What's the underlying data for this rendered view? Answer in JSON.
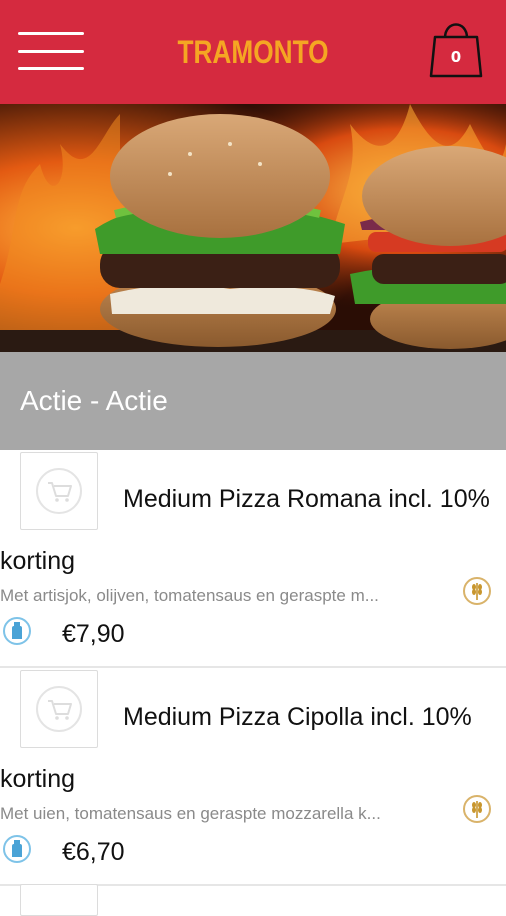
{
  "header": {
    "brand": "TRAMONTO",
    "cart_count": "0",
    "menu_icon": "hamburger-menu-icon",
    "cart_icon": "shopping-bag-icon",
    "background_color": "#d52a3f",
    "brand_color": "#f5a623"
  },
  "hero": {
    "image": "burgers-with-flames"
  },
  "section": {
    "title": "Actie - Actie",
    "background_color": "#a7a7a7"
  },
  "products": [
    {
      "title": "Medium Pizza Romana incl. 10% korting",
      "description": "Met artisjok, olijven, tomatensaus en geraspte m...",
      "price": "€7,90",
      "thumb_icon": "cart-placeholder-icon",
      "allergen_icon": "wheat-gluten-icon",
      "extra_icon": "bottle-icon"
    },
    {
      "title": "Medium Pizza Cipolla incl. 10% korting",
      "description": "Met uien, tomatensaus en geraspte mozzarella k...",
      "price": "€6,70",
      "thumb_icon": "cart-placeholder-icon",
      "allergen_icon": "wheat-gluten-icon",
      "extra_icon": "bottle-icon"
    }
  ]
}
